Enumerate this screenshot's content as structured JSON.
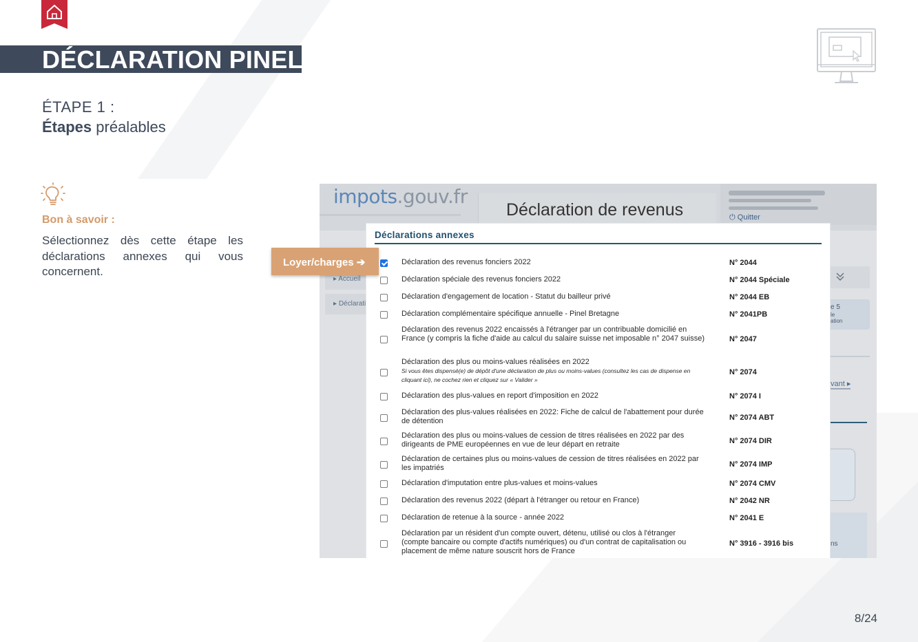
{
  "logo": {
    "badge_text": "PINEL",
    "icon": "house-icon"
  },
  "header": {
    "title": "DÉCLARATION PINEL"
  },
  "step": {
    "number_label": "ÉTAPE 1 :",
    "title_bold": "Étapes",
    "title_rest": " préalables"
  },
  "tip": {
    "icon": "lightbulb-icon",
    "title": "Bon à savoir :",
    "body": "Sélectionnez dès cette étape les déclarations annexes qui vous concernent."
  },
  "callout": {
    "label": "Loyer/charges",
    "icon": "arrow-right-icon"
  },
  "page_number": "8/24",
  "screenshot": {
    "brand_blue": "impots",
    "brand_gray": ".gouv.fr",
    "title": "Déclaration de revenus",
    "quit_label": "Quitter",
    "side_items": [
      "Accueil",
      "Déclarati"
    ],
    "right_fragments": [
      "e 5",
      "le",
      "ation",
      "vant",
      "ns"
    ],
    "modal": {
      "title": "Déclarations annexes",
      "rows": [
        {
          "label": "Déclaration des revenus fonciers 2022",
          "code": "N° 2044",
          "checked": true
        },
        {
          "label": "Déclaration spéciale des revenus fonciers 2022",
          "code": "N° 2044 Spéciale",
          "checked": false
        },
        {
          "label": "Déclaration d'engagement de location - Statut du bailleur privé",
          "code": "N° 2044 EB",
          "checked": false
        },
        {
          "label": "Déclaration complémentaire spécifique annuelle - Pinel Bretagne",
          "code": "N° 2041PB",
          "checked": false
        },
        {
          "label": "Déclaration des revenus 2022 encaissés à l'étranger par un contribuable domicilié en France (y compris la fiche d'aide au calcul du salaire suisse net imposable n° 2047 suisse)",
          "code": "N° 2047",
          "checked": false
        },
        {
          "label": "Déclaration des plus ou moins-values réalisées en 2022",
          "sub": "Si vous êtes dispensé(e) de dépôt d'une déclaration de plus ou moins-values (consultez les cas de dispense en cliquant ici), ne cochez rien et cliquez sur « Valider »",
          "code": "N° 2074",
          "checked": false
        },
        {
          "label": "Déclaration des plus-values en report d'imposition en 2022",
          "code": "N° 2074 I",
          "checked": false
        },
        {
          "label": "Déclaration des plus-values réalisées en 2022: Fiche de calcul de l'abattement pour durée de détention",
          "code": "N° 2074 ABT",
          "checked": false
        },
        {
          "label": "Déclaration des plus ou moins-values de cession de titres réalisées en 2022 par des dirigeants de PME européennes en vue de leur départ en retraite",
          "code": "N° 2074 DIR",
          "checked": false
        },
        {
          "label": "Déclaration de certaines plus ou moins-values de cession de titres réalisées en 2022 par les impatriés",
          "code": "N° 2074 IMP",
          "checked": false
        },
        {
          "label": "Déclaration d'imputation entre plus-values et moins-values",
          "code": "N° 2074 CMV",
          "checked": false
        },
        {
          "label": "Déclaration des revenus 2022 (départ à l'étranger ou retour en France)",
          "code": "N° 2042 NR",
          "checked": false
        },
        {
          "label": "Déclaration de retenue à la source - année 2022",
          "code": "N° 2041 E",
          "checked": false
        },
        {
          "label": "Déclaration par un résident d'un compte ouvert, détenu, utilisé ou clos à l'étranger (compte bancaire ou compte d'actifs numériques) ou d'un contrat de capitalisation ou placement de même nature souscrit hors de France",
          "code": "N° 3916 - 3916 bis",
          "checked": false
        }
      ]
    }
  },
  "colors": {
    "header_bg": "#3e4a5b",
    "accent_orange": "#d9a274",
    "logo_red": "#c8283a",
    "modal_title": "#1f4f6e"
  }
}
